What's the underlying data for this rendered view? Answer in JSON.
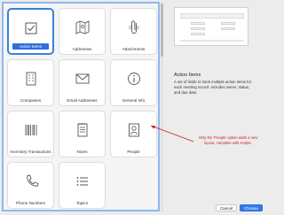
{
  "layouts": [
    {
      "label": "Action Items",
      "icon": "checkbox-icon",
      "selected": true
    },
    {
      "label": "Addresses",
      "icon": "map-icon",
      "selected": false
    },
    {
      "label": "Attachments",
      "icon": "paperclip-icon",
      "selected": false
    },
    {
      "label": "Companies",
      "icon": "building-icon",
      "selected": false
    },
    {
      "label": "Email Addresses",
      "icon": "envelope-icon",
      "selected": false
    },
    {
      "label": "General Info",
      "icon": "info-icon",
      "selected": false
    },
    {
      "label": "Inventory Transactions",
      "icon": "barcode-icon",
      "selected": false
    },
    {
      "label": "Notes",
      "icon": "notepad-icon",
      "selected": false
    },
    {
      "label": "People",
      "icon": "person-id-icon",
      "selected": false
    },
    {
      "label": "Phone Numbers",
      "icon": "phone-icon",
      "selected": false
    },
    {
      "label": "Topics",
      "icon": "list-icon",
      "selected": false
    }
  ],
  "detail": {
    "title": "Action Items",
    "description": "A set of fields to track multiple action items for each meeting record. Includes owner, status, and due date."
  },
  "annotation": {
    "text": "Only the 'People' option adds a new layout, complete with scripts.",
    "color": "#cc1f1f"
  },
  "buttons": {
    "cancel": "Cancel",
    "choose": "Choose"
  },
  "colors": {
    "accent": "#2f7bea",
    "selection": "#3b82d6"
  }
}
